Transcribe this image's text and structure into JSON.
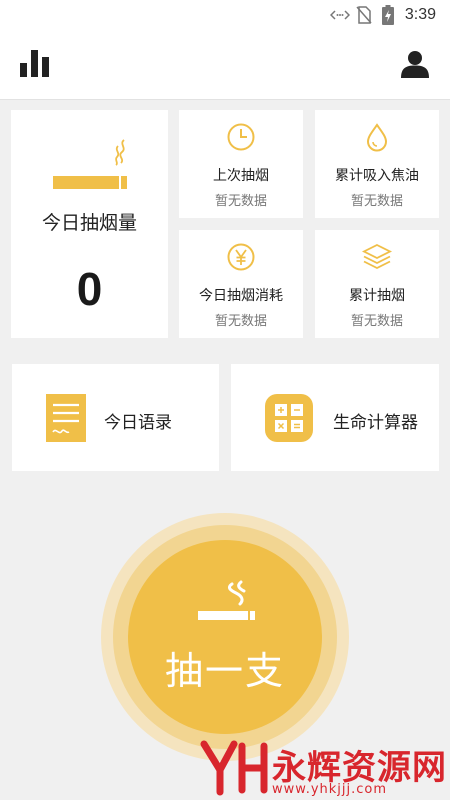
{
  "status_bar": {
    "time": "3:39"
  },
  "colors": {
    "accent": "#f0bf48",
    "accent_light": "#f2d591",
    "accent_pale": "#f5e4bf",
    "background": "#f0f0f0",
    "watermark": "#d8262d"
  },
  "header": {
    "left_icon": "bar-chart-icon",
    "right_icon": "user-icon"
  },
  "today_card": {
    "title": "今日抽烟量",
    "count": "0",
    "icon": "cigarette-icon"
  },
  "stats": [
    {
      "icon": "clock-icon",
      "title": "上次抽烟",
      "value": "暂无数据"
    },
    {
      "icon": "drop-icon",
      "title": "累计吸入焦油",
      "value": "暂无数据"
    },
    {
      "icon": "yen-icon",
      "title": "今日抽烟消耗",
      "value": "暂无数据"
    },
    {
      "icon": "layers-icon",
      "title": "累计抽烟",
      "value": "暂无数据"
    }
  ],
  "shortcuts": [
    {
      "icon": "note-icon",
      "label": "今日语录"
    },
    {
      "icon": "calculator-icon",
      "label": "生命计算器"
    }
  ],
  "smoke_button": {
    "label": "抽一支",
    "icon": "cigarette-icon"
  },
  "watermark": {
    "brand": "永辉资源网",
    "url": "www.yhkjjj.com"
  }
}
